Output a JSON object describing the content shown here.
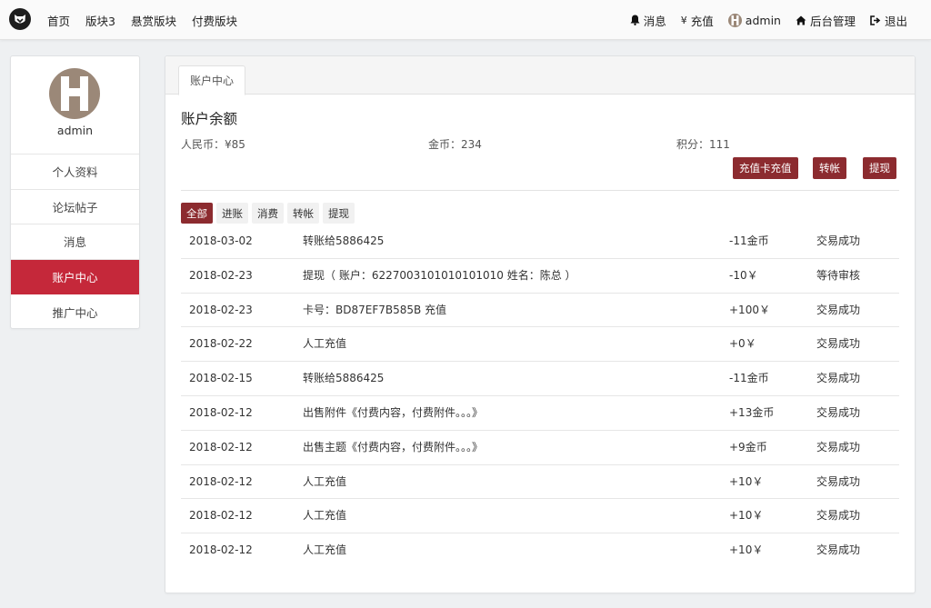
{
  "nav": {
    "links": [
      "首页",
      "版块3",
      "悬赏版块",
      "付费版块"
    ],
    "messages": "消息",
    "recharge": "充值",
    "recharge_icon": "¥",
    "username": "admin",
    "admin": "后台管理",
    "logout": "退出"
  },
  "sidebar": {
    "username": "admin",
    "items": [
      "个人资料",
      "论坛帖子",
      "消息",
      "账户中心",
      "推广中心"
    ],
    "active_index": 3
  },
  "main": {
    "tab": "账户中心",
    "balance_title": "账户余额",
    "rmb_label": "人民币：",
    "rmb_value": "¥85",
    "gold_label": "金币：",
    "gold_value": "234",
    "points_label": "积分：",
    "points_value": "111",
    "buttons": [
      "充值卡充值",
      "转帐",
      "提现"
    ],
    "filters": [
      "全部",
      "进账",
      "消费",
      "转帐",
      "提现"
    ],
    "active_filter": 0
  },
  "transactions": [
    {
      "date": "2018-03-02",
      "desc": "转账给5886425",
      "amount": "-11金币",
      "status": "交易成功"
    },
    {
      "date": "2018-02-23",
      "desc": "提现（ 账户：6227003101010101010 姓名：陈总 ）",
      "amount": "-10￥",
      "status": "等待审核"
    },
    {
      "date": "2018-02-23",
      "desc": "卡号：BD87EF7B585B 充值",
      "amount": "+100￥",
      "status": "交易成功"
    },
    {
      "date": "2018-02-22",
      "desc": "人工充值",
      "amount": "+0￥",
      "status": "交易成功"
    },
    {
      "date": "2018-02-15",
      "desc": "转账给5886425",
      "amount": "-11金币",
      "status": "交易成功"
    },
    {
      "date": "2018-02-12",
      "desc": "出售附件《付费内容，付费附件。。。》",
      "amount": "+13金币",
      "status": "交易成功"
    },
    {
      "date": "2018-02-12",
      "desc": "出售主题《付费内容，付费附件。。。》",
      "amount": "+9金币",
      "status": "交易成功"
    },
    {
      "date": "2018-02-12",
      "desc": "人工充值",
      "amount": "+10￥",
      "status": "交易成功"
    },
    {
      "date": "2018-02-12",
      "desc": "人工充值",
      "amount": "+10￥",
      "status": "交易成功"
    },
    {
      "date": "2018-02-12",
      "desc": "人工充值",
      "amount": "+10￥",
      "status": "交易成功"
    }
  ],
  "colors": {
    "accent": "#c5283a",
    "button": "#8c2b2f",
    "avatar": "#9b8878"
  },
  "icons": {
    "logo": "cat-logo-icon",
    "messages": "bell-icon",
    "recharge": "yen-icon",
    "admin": "home-icon",
    "logout": "sign-out-icon"
  }
}
